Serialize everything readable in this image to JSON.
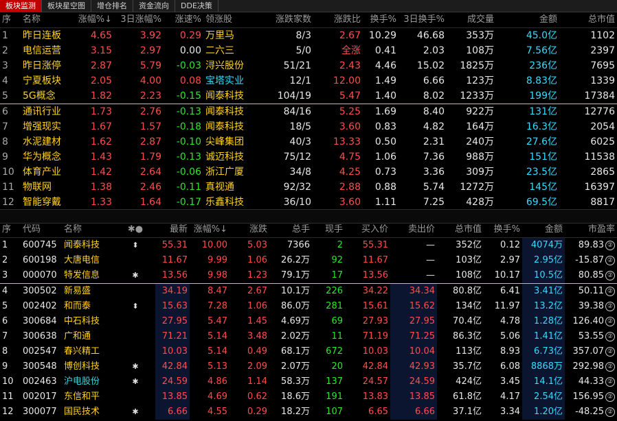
{
  "tabs": [
    "板块监测",
    "板块星空图",
    "增仓排名",
    "资金流向",
    "DDE决策"
  ],
  "top": {
    "headers": [
      "序",
      "名称",
      "涨幅%↓",
      "3日涨幅%",
      "涨速%",
      "领涨股",
      "涨跌家数",
      "涨跌比",
      "换手%",
      "3日换手%",
      "成交量",
      "金额",
      "总市值"
    ],
    "rows": [
      [
        "1",
        "昨日连板",
        "4.65",
        "3.92",
        "0.29",
        "万里马",
        "8/3",
        "2.67",
        "10.29",
        "46.68",
        "353万",
        "45.0亿",
        "1102"
      ],
      [
        "2",
        "电信运营",
        "3.15",
        "2.97",
        "0.00",
        "二六三",
        "5/0",
        "全涨",
        "0.41",
        "2.03",
        "108万",
        "7.56亿",
        "2397"
      ],
      [
        "3",
        "昨日涨停",
        "2.87",
        "5.79",
        "-0.03",
        "浔兴股份",
        "51/21",
        "2.43",
        "4.46",
        "15.02",
        "1825万",
        "236亿",
        "7695"
      ],
      [
        "4",
        "宁夏板块",
        "2.05",
        "4.00",
        "0.08",
        "宝塔实业",
        "12/1",
        "12.00",
        "1.49",
        "6.66",
        "123万",
        "8.83亿",
        "1339"
      ],
      [
        "5",
        "5G概念",
        "1.82",
        "2.23",
        "-0.15",
        "闻泰科技",
        "104/19",
        "5.47",
        "1.40",
        "8.02",
        "1233万",
        "199亿",
        "17384"
      ],
      [
        "6",
        "通讯行业",
        "1.73",
        "2.76",
        "-0.13",
        "闻泰科技",
        "84/16",
        "5.25",
        "1.69",
        "8.40",
        "922万",
        "131亿",
        "12776"
      ],
      [
        "7",
        "增强现实",
        "1.67",
        "1.57",
        "-0.18",
        "闻泰科技",
        "18/5",
        "3.60",
        "0.83",
        "4.82",
        "164万",
        "16.3亿",
        "2054"
      ],
      [
        "8",
        "水泥建材",
        "1.62",
        "2.87",
        "-0.10",
        "尖峰集团",
        "40/3",
        "13.33",
        "0.50",
        "2.31",
        "240万",
        "27.6亿",
        "6025"
      ],
      [
        "9",
        "华为概念",
        "1.43",
        "1.79",
        "-0.13",
        "诚迈科技",
        "75/12",
        "4.75",
        "1.06",
        "7.36",
        "988万",
        "151亿",
        "11538"
      ],
      [
        "10",
        "体育产业",
        "1.42",
        "2.64",
        "-0.06",
        "浙江广厦",
        "34/8",
        "4.25",
        "0.73",
        "3.36",
        "309万",
        "23.5亿",
        "2865"
      ],
      [
        "11",
        "物联网",
        "1.38",
        "2.46",
        "-0.11",
        "真视通",
        "92/32",
        "2.88",
        "0.88",
        "5.74",
        "1272万",
        "145亿",
        "16397"
      ],
      [
        "12",
        "智能穿戴",
        "1.33",
        "1.64",
        "-0.17",
        "乐鑫科技",
        "36/10",
        "3.60",
        "1.11",
        "7.25",
        "428万",
        "69.5亿",
        "8817"
      ]
    ]
  },
  "bottom": {
    "headers": [
      "序",
      "代码",
      "名称",
      "✱●",
      "最新",
      "涨幅%↓",
      "涨跌",
      "总手",
      "现手",
      "买入价",
      "卖出价",
      "总市值",
      "换手%",
      "金额",
      "市盈率"
    ],
    "rows": [
      [
        "1",
        "600745",
        "闻泰科技",
        "⬍",
        "55.31",
        "10.00",
        "5.03",
        "7366",
        "2",
        "55.31",
        "—",
        "352亿",
        "0.12",
        "4074万",
        "89.83",
        "②"
      ],
      [
        "2",
        "600198",
        "大唐电信",
        "",
        "11.67",
        "9.99",
        "1.06",
        "26.2万",
        "92",
        "11.67",
        "—",
        "103亿",
        "2.97",
        "2.95亿",
        "-15.87",
        "②"
      ],
      [
        "3",
        "000070",
        "特发信息",
        "✱",
        "13.56",
        "9.98",
        "1.23",
        "79.1万",
        "17",
        "13.56",
        "—",
        "108亿",
        "10.17",
        "10.5亿",
        "80.85",
        "②"
      ],
      [
        "4",
        "300502",
        "新易盛",
        "",
        "34.19",
        "8.47",
        "2.67",
        "10.1万",
        "226",
        "34.22",
        "34.34",
        "80.8亿",
        "6.41",
        "3.41亿",
        "50.11",
        "②"
      ],
      [
        "5",
        "002402",
        "和而泰",
        "⬍",
        "15.63",
        "7.28",
        "1.06",
        "86.0万",
        "281",
        "15.61",
        "15.62",
        "134亿",
        "11.97",
        "13.2亿",
        "39.38",
        "②"
      ],
      [
        "6",
        "300684",
        "中石科技",
        "",
        "27.95",
        "5.47",
        "1.45",
        "4.69万",
        "69",
        "27.93",
        "27.95",
        "70.4亿",
        "4.78",
        "1.28亿",
        "126.40",
        "②"
      ],
      [
        "7",
        "300638",
        "广和通",
        "",
        "71.21",
        "5.14",
        "3.48",
        "2.02万",
        "11",
        "71.19",
        "71.25",
        "86.3亿",
        "5.06",
        "1.41亿",
        "53.55",
        "②"
      ],
      [
        "8",
        "002547",
        "春兴精工",
        "",
        "10.03",
        "5.14",
        "0.49",
        "68.1万",
        "672",
        "10.03",
        "10.04",
        "113亿",
        "8.93",
        "6.73亿",
        "357.07",
        "②"
      ],
      [
        "9",
        "300548",
        "博创科技",
        "✱",
        "42.84",
        "5.13",
        "2.09",
        "2.07万",
        "20",
        "42.84",
        "42.93",
        "35.7亿",
        "6.08",
        "8868万",
        "292.98",
        "②"
      ],
      [
        "10",
        "002463",
        "沪电股份",
        "✱",
        "24.59",
        "4.86",
        "1.14",
        "58.3万",
        "137",
        "24.57",
        "24.59",
        "424亿",
        "3.45",
        "14.1亿",
        "44.33",
        "②"
      ],
      [
        "11",
        "002017",
        "东信和平",
        "",
        "13.85",
        "4.69",
        "0.62",
        "18.6万",
        "191",
        "13.83",
        "13.85",
        "61.8亿",
        "4.17",
        "2.54亿",
        "156.95",
        "②"
      ],
      [
        "12",
        "300077",
        "国民技术",
        "✱",
        "6.66",
        "4.55",
        "0.29",
        "18.2万",
        "107",
        "6.65",
        "6.66",
        "37.1亿",
        "3.34",
        "1.20亿",
        "-48.25",
        "②"
      ]
    ]
  }
}
